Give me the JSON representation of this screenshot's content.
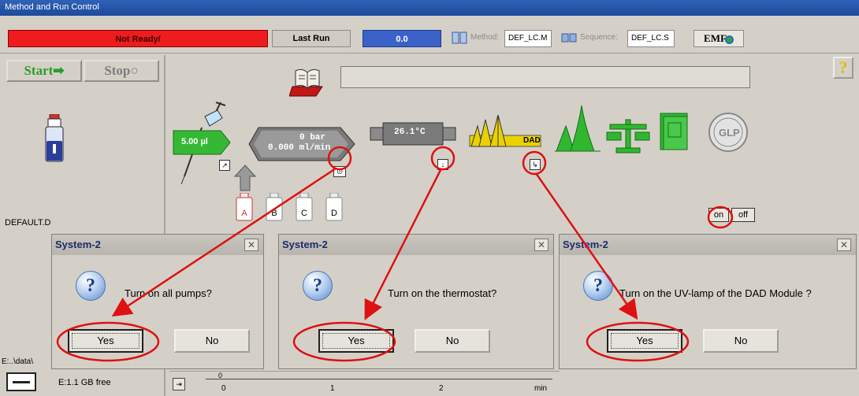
{
  "window": {
    "title": "Method and Run Control"
  },
  "status": {
    "state": "Not Ready/",
    "last_run_label": "Last Run",
    "last_run_value": "0.0",
    "method_label": "Method:",
    "method_value": "DEF_LC.M",
    "sequence_label": "Sequence:",
    "sequence_value": "DEF_LC.S",
    "emf_label": "EMF"
  },
  "left_panel": {
    "start_label": "Start",
    "stop_label": "Stop",
    "data_file": "DEFAULT.D",
    "data_path": "E:..\\data\\",
    "disk_free": "E:1.1 GB free"
  },
  "modules": {
    "injector_volume": "5.00 µl",
    "pump_pressure": "0 bar",
    "pump_flow": "0.000 ml/min",
    "column_temp": "26.1°C",
    "dad_label": "DAD",
    "glp_label": "GLP",
    "bottles": [
      "A",
      "B",
      "C",
      "D"
    ],
    "lamp_on_label": "on",
    "lamp_off_label": "off",
    "help_label": "?"
  },
  "dialogs": [
    {
      "title": "System-2",
      "question": "Turn on all pumps?",
      "yes": "Yes",
      "no": "No"
    },
    {
      "title": "System-2",
      "question": "Turn on the thermostat?",
      "yes": "Yes",
      "no": "No"
    },
    {
      "title": "System-2",
      "question": "Turn on the UV-lamp of the DAD Module ?",
      "yes": "Yes",
      "no": "No"
    }
  ],
  "timeline": {
    "ticks": [
      "0",
      "1",
      "2"
    ],
    "zero_top": "0",
    "unit": "min"
  },
  "colors": {
    "not_ready": "#ee1c1c",
    "last_run_bg": "#3a62c8",
    "annotation": "#dd1111",
    "module_green": "#2fb82f",
    "module_yellow": "#ecd400"
  }
}
